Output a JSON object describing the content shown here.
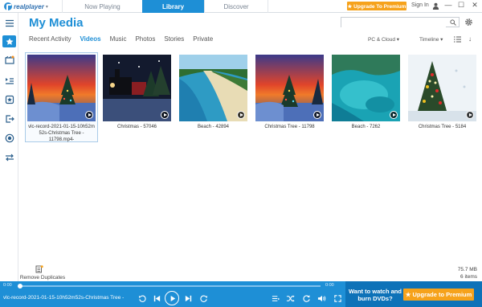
{
  "app": {
    "logo_text": "realplayer",
    "tabs": [
      {
        "label": "Now Playing"
      },
      {
        "label": "Library"
      },
      {
        "label": "Discover"
      }
    ],
    "upgrade_top_label": "★ Upgrade To Premium",
    "sign_in_label": "Sign In",
    "window_controls": [
      "—",
      "☐",
      "✕"
    ]
  },
  "sidebar": {
    "icons": [
      "menu-icon",
      "home-icon",
      "video-icon",
      "playlist-icon",
      "stories-icon",
      "exit-icon",
      "record-icon",
      "transfer-icon"
    ]
  },
  "header": {
    "title": "My Media",
    "search_placeholder": "",
    "nav": [
      {
        "label": "Recent Activity"
      },
      {
        "label": "Videos"
      },
      {
        "label": "Music"
      },
      {
        "label": "Photos"
      },
      {
        "label": "Stories"
      },
      {
        "label": "Private"
      }
    ],
    "active_nav": "Videos",
    "source_filter": "PC & Cloud",
    "view_filter": "Timeline"
  },
  "media": {
    "items": [
      {
        "caption": "vlc-record-2021-01-15-10h52m 52s-Christmas Tree - 11798.mp4-",
        "theme": "christmas-tree-sunset"
      },
      {
        "caption": "Christmas - 57046",
        "theme": "train-night"
      },
      {
        "caption": "Beach - 42894",
        "theme": "beach-aerial"
      },
      {
        "caption": "Christmas Tree - 11798",
        "theme": "christmas-tree-sunset"
      },
      {
        "caption": "Beach - 7262",
        "theme": "turquoise-water"
      },
      {
        "caption": "Christmas Tree - 5184",
        "theme": "lit-tree"
      }
    ]
  },
  "footer": {
    "remove_duplicates_label": "Remove Duplicates",
    "size": "75.7 MB",
    "items": "6 items"
  },
  "player": {
    "time_elapsed": "0:00",
    "time_total": "0:00",
    "progress": 0,
    "now_playing": "vlc-record-2021-01-15-10h52m52s-Christmas Tree -",
    "promo_text": "Want to watch and burn DVDs?",
    "upgrade_label": "★ Upgrade to Premium"
  }
}
